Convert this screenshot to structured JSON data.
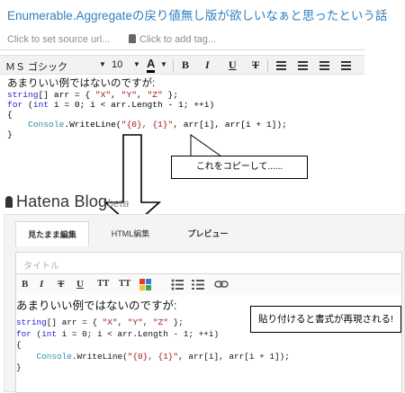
{
  "evernote": {
    "note_title": "Enumerable.Aggregateの戻り値無し版が欲しいなぁと思ったという話",
    "source_url_placeholder": "Click to set source url...",
    "tag_placeholder": "Click to add tag...",
    "toolbar": {
      "font_name": "ＭＳ ゴシック",
      "font_size": "10",
      "color_a": "A",
      "bold": "B",
      "italic": "I",
      "underline": "U",
      "strike": "T"
    },
    "intro_text": "あまりいい例ではないのですが:",
    "code": {
      "line1": [
        "string",
        "[] arr = { ",
        "\"X\"",
        ", ",
        "\"Y\"",
        ", ",
        "\"Z\"",
        " };"
      ],
      "line2": [
        "for",
        " (",
        "int",
        " i = 0; i < arr.Length - 1; ++i)"
      ],
      "line3": "{",
      "line4": [
        "Console",
        ".WriteLine(",
        "\"{0}, {1}\"",
        ", arr[i], arr[i + 1]);"
      ],
      "line5": "}"
    }
  },
  "callouts": {
    "copy": "これをコピーして......",
    "paste": "貼り付けると書式が再現される!"
  },
  "hatena": {
    "logo_text": "Hatena Blog",
    "logo_beta": "beta",
    "tabs": [
      "見たまま編集",
      "HTML編集",
      "プレビュー"
    ],
    "title_placeholder": "タイトル",
    "toolbar": {
      "bold": "B",
      "italic": "I",
      "strike": "T",
      "underline": "U",
      "size_up": "TT",
      "size_down": "TT"
    },
    "intro_text": "あまりいい例ではないのですが:"
  },
  "colors": {
    "title_blue": "#2f7fc1",
    "keyword": "#1f1fd0",
    "string": "#a31515",
    "type": "#2b91af"
  }
}
